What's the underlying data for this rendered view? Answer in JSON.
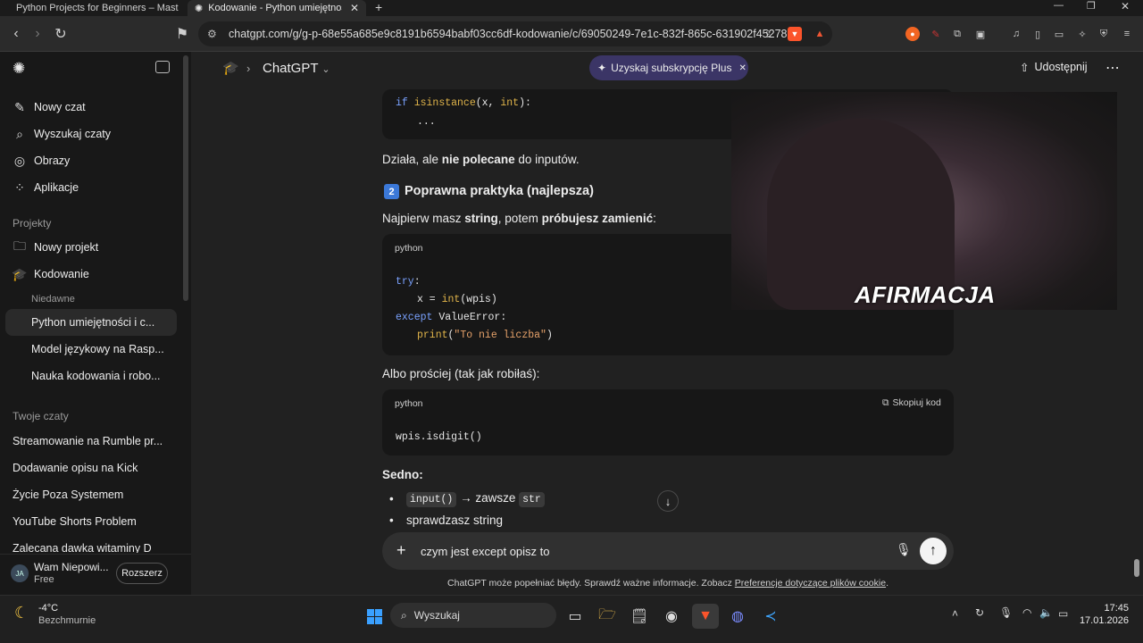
{
  "browser": {
    "tabs": [
      {
        "title": "Python Projects for Beginners – Mast",
        "active": false
      },
      {
        "title": "Kodowanie - Python umiejętności",
        "active": true
      }
    ],
    "new_tab": "+",
    "url": "chatgpt.com/g/g-p-68e55a685e9c8191b6594babf03cc6df-kodowanie/c/69050249-7e1c-832f-865c-631902f45278"
  },
  "sidebar": {
    "actions": [
      "Nowy czat",
      "Wyszukaj czaty",
      "Obrazy",
      "Aplikacje"
    ],
    "projects_heading": "Projekty",
    "projects": [
      "Nowy projekt",
      "Kodowanie"
    ],
    "recent_heading": "Niedawne",
    "recent": [
      "Python umiejętności i c...",
      "Model językowy na Rasp...",
      "Nauka kodowania i robo..."
    ],
    "chats_heading": "Twoje czaty",
    "chats": [
      "Streamowanie na Rumble pr...",
      "Dodawanie opisu na Kick",
      "Życie Poza Systemem",
      "YouTube Shorts Problem",
      "Zalecana dawka witaminy D"
    ],
    "user": {
      "initials": "JA",
      "name": "Wam Niepowi...",
      "plan": "Free",
      "upgrade": "Rozszerz"
    }
  },
  "header": {
    "model": "ChatGPT",
    "promo": "Uzyskaj subskrypcję Plus",
    "share": "Udostępnij"
  },
  "content": {
    "code_top": {
      "line1": [
        "if ",
        "isinstance",
        "(x, ",
        "int",
        "):"
      ],
      "line2": "..."
    },
    "p1": {
      "pre": "Działa, ale ",
      "bold": "nie polecane",
      "post": " do inputów."
    },
    "heading2": {
      "num": "2",
      "text": "Poprawna praktyka (najlepsza)"
    },
    "p2": {
      "pre": "Najpierw masz ",
      "b1": "string",
      "mid": ", potem ",
      "b2": "próbujesz zamienić",
      "post": ":"
    },
    "code2": {
      "lang": "python",
      "lines": [
        [
          "try",
          ":"
        ],
        [
          "x = ",
          "int",
          "(wpis)"
        ],
        [
          "except ",
          "ValueError:"
        ],
        [
          "print",
          "(",
          "\"To nie liczba\"",
          ")"
        ]
      ]
    },
    "p3": "Albo prościej (tak jak robiłaś):",
    "code3": {
      "lang": "python",
      "copy": "Skopiuj kod",
      "line": "wpis.isdigit()"
    },
    "sedno": "Sedno:",
    "bullets": [
      {
        "code1": "input()",
        "text": " → zawsze ",
        "code2": "str"
      },
      {
        "text": "sprawdzasz string"
      }
    ]
  },
  "webcam": {
    "overlay": "AFIRMACJA"
  },
  "composer": {
    "value": "czym jest except opisz to "
  },
  "footer": {
    "text": "ChatGPT może popełniać błędy. Sprawdź ważne informacje. Zobacz ",
    "link": "Preferencje dotyczące plików cookie",
    "end": "."
  },
  "taskbar": {
    "weather": {
      "temp": "-4°C",
      "desc": "Bezchmurnie"
    },
    "search": "Wyszukaj",
    "time": "17:45",
    "date": "17.01.2026"
  }
}
